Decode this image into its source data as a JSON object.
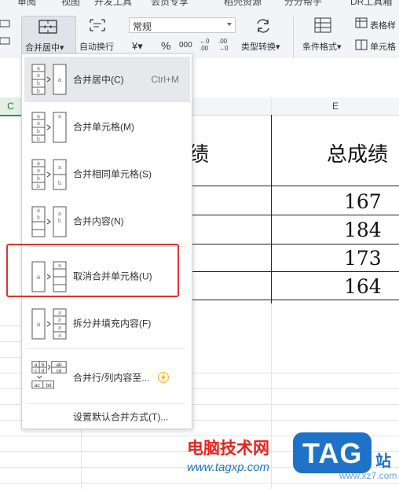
{
  "tabs": [
    "审阅",
    "视图",
    "开发工具",
    "会员专享",
    "稻壳资源",
    "分分帮手",
    "DR工具箱"
  ],
  "ribbon": {
    "merge_label": "合并居中▾",
    "wrap_label": "自动换行",
    "number_format": "常规",
    "currency": "¥▾",
    "percent": "%",
    "thousands": "000",
    "dec_inc": "←0 .00",
    "dec_dec": ".00 →0",
    "convert_label": "类型转换▾",
    "cond_format_label": "条件格式▾",
    "table_style_label": "表格样",
    "cell_label": "单元格"
  },
  "sheet": {
    "col_c": "C",
    "col_e": "E",
    "header_partial": "绩",
    "header_total": "总成绩",
    "totals": [
      "167",
      "184",
      "173",
      "164"
    ]
  },
  "menu": {
    "items": [
      {
        "label": "合并居中(C)",
        "shortcut": "Ctrl+M",
        "icon": "merge-center-icon"
      },
      {
        "label": "合并单元格(M)",
        "shortcut": "",
        "icon": "merge-cells-icon"
      },
      {
        "label": "合并相同单元格(S)",
        "shortcut": "",
        "icon": "merge-same-cells-icon"
      },
      {
        "label": "合并内容(N)",
        "shortcut": "",
        "icon": "merge-content-icon"
      },
      {
        "label": "取消合并单元格(U)",
        "shortcut": "",
        "icon": "unmerge-cells-icon"
      },
      {
        "label": "拆分并填充内容(F)",
        "shortcut": "",
        "icon": "split-fill-icon"
      },
      {
        "label": "合并行/列内容至...",
        "shortcut": "",
        "icon": "merge-row-col-icon"
      }
    ],
    "footer": "设置默认合并方式(T)..."
  },
  "watermark": {
    "site_cn": "电脑技术网",
    "url": "www.tagxp.com",
    "logo": "TAG",
    "suffix": "站",
    "url2": "www.xz7.com"
  },
  "colors": {
    "highlight_box": "#e0342b",
    "selected_col": "#1e9c3b",
    "watermark_red": "#e8231b",
    "watermark_blue": "#1e73c8"
  }
}
